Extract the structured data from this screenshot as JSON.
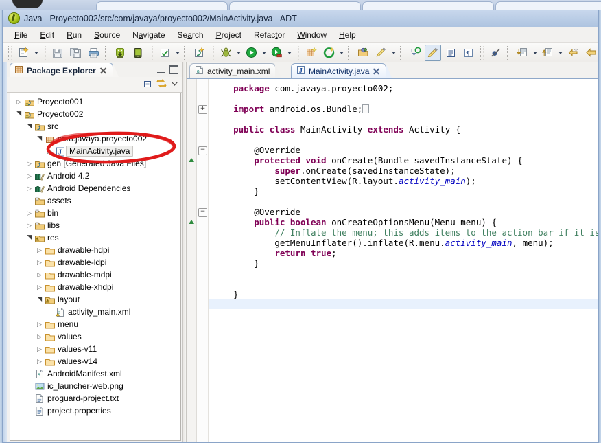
{
  "window": {
    "title": "Java - Proyecto002/src/com/javaya/proyecto002/MainActivity.java - ADT",
    "app_icon": "eclipse-icon"
  },
  "menubar": {
    "items": [
      {
        "label": "File",
        "mnemonic": "F"
      },
      {
        "label": "Edit",
        "mnemonic": "E"
      },
      {
        "label": "Run",
        "mnemonic": "R"
      },
      {
        "label": "Source",
        "mnemonic": "S"
      },
      {
        "label": "Navigate",
        "mnemonic": "N"
      },
      {
        "label": "Search",
        "mnemonic": "a"
      },
      {
        "label": "Project",
        "mnemonic": "P"
      },
      {
        "label": "Refactor",
        "mnemonic": "t"
      },
      {
        "label": "Window",
        "mnemonic": "W"
      },
      {
        "label": "Help",
        "mnemonic": "H"
      }
    ]
  },
  "toolbar": {
    "groups": [
      [
        "new-wizard-icon",
        "dropdown-arrow"
      ],
      [
        "save-icon",
        "save-all-icon",
        "print-icon"
      ],
      [
        "android-sdk-manager-icon",
        "android-virtual-device-manager-icon"
      ],
      [
        "check-build-icon",
        "dropdown-arrow"
      ],
      [
        "new-java-class-icon"
      ],
      [
        "debug-icon",
        "dropdown-arrow",
        "run-icon",
        "dropdown-arrow",
        "run-external-tools-icon",
        "dropdown-arrow"
      ],
      [
        "new-android-xml-icon",
        "refresh-green-icon",
        "dropdown-arrow"
      ],
      [
        "open-package-icon",
        "open-type-icon",
        "dropdown-arrow"
      ],
      [
        "search-declaration-icon",
        "toggle-mark-occurrences-icon",
        "show-whitespace-icon",
        "show-pilcrow-icon"
      ],
      [
        "skip-breakpoints-icon"
      ],
      [
        "next-annotation-icon",
        "dropdown-arrow",
        "previous-annotation-icon",
        "dropdown-arrow",
        "last-edit-location-icon",
        "back-icon",
        "dropdown-arrow",
        "forward-icon"
      ]
    ]
  },
  "explorer": {
    "tab_label": "Package Explorer",
    "tab_icon": "package-explorer-icon",
    "close_icon": "close-icon",
    "minimize_icon": "minimize-icon",
    "maximize_icon": "maximize-icon",
    "toolbar_icons": [
      "collapse-all-icon",
      "link-with-editor-icon",
      "view-menu-icon"
    ],
    "tree": [
      {
        "label": "Proyecto001",
        "indent": 0,
        "twisty": "closed",
        "icon": "java-project-icon"
      },
      {
        "label": "Proyecto002",
        "indent": 0,
        "twisty": "open",
        "icon": "java-project-icon"
      },
      {
        "label": "src",
        "indent": 1,
        "twisty": "open",
        "icon": "source-folder-icon"
      },
      {
        "label": "com.javaya.proyecto002",
        "indent": 2,
        "twisty": "open",
        "icon": "package-icon"
      },
      {
        "label": "MainActivity.java",
        "indent": 3,
        "twisty": "closed",
        "icon": "java-file-icon",
        "selected": true
      },
      {
        "label": "gen [Generated Java Files]",
        "indent": 1,
        "twisty": "closed",
        "icon": "source-folder-icon"
      },
      {
        "label": "Android 4.2",
        "indent": 1,
        "twisty": "closed",
        "icon": "library-icon"
      },
      {
        "label": "Android Dependencies",
        "indent": 1,
        "twisty": "closed",
        "icon": "library-icon"
      },
      {
        "label": "assets",
        "indent": 1,
        "twisty": "none",
        "icon": "folder-badge-icon"
      },
      {
        "label": "bin",
        "indent": 1,
        "twisty": "closed",
        "icon": "folder-badge-icon"
      },
      {
        "label": "libs",
        "indent": 1,
        "twisty": "closed",
        "icon": "folder-badge-icon"
      },
      {
        "label": "res",
        "indent": 1,
        "twisty": "open",
        "icon": "folder-warning-icon"
      },
      {
        "label": "drawable-hdpi",
        "indent": 2,
        "twisty": "closed",
        "icon": "folder-icon"
      },
      {
        "label": "drawable-ldpi",
        "indent": 2,
        "twisty": "closed",
        "icon": "folder-icon"
      },
      {
        "label": "drawable-mdpi",
        "indent": 2,
        "twisty": "closed",
        "icon": "folder-icon"
      },
      {
        "label": "drawable-xhdpi",
        "indent": 2,
        "twisty": "closed",
        "icon": "folder-icon"
      },
      {
        "label": "layout",
        "indent": 2,
        "twisty": "open",
        "icon": "folder-warning-icon"
      },
      {
        "label": "activity_main.xml",
        "indent": 3,
        "twisty": "none",
        "icon": "xml-warning-file-icon"
      },
      {
        "label": "menu",
        "indent": 2,
        "twisty": "closed",
        "icon": "folder-icon"
      },
      {
        "label": "values",
        "indent": 2,
        "twisty": "closed",
        "icon": "folder-icon"
      },
      {
        "label": "values-v11",
        "indent": 2,
        "twisty": "closed",
        "icon": "folder-icon"
      },
      {
        "label": "values-v14",
        "indent": 2,
        "twisty": "closed",
        "icon": "folder-icon"
      },
      {
        "label": "AndroidManifest.xml",
        "indent": 1,
        "twisty": "none",
        "icon": "xml-file-icon"
      },
      {
        "label": "ic_launcher-web.png",
        "indent": 1,
        "twisty": "none",
        "icon": "image-file-icon"
      },
      {
        "label": "proguard-project.txt",
        "indent": 1,
        "twisty": "none",
        "icon": "text-file-icon"
      },
      {
        "label": "project.properties",
        "indent": 1,
        "twisty": "none",
        "icon": "text-file-icon"
      }
    ]
  },
  "editor": {
    "tabs": [
      {
        "label": "activity_main.xml",
        "icon": "xml-file-icon",
        "active": false,
        "closable": false
      },
      {
        "label": "MainActivity.java",
        "icon": "java-file-icon",
        "active": true,
        "closable": true
      }
    ],
    "minimize_icon": "minimize-icon",
    "maximize_icon": "maximize-icon",
    "code_lines": [
      {
        "tokens": [
          {
            "t": "package ",
            "c": "kw"
          },
          {
            "t": "com.javaya.proyecto002;",
            "c": "pln"
          }
        ],
        "indent": 1
      },
      {
        "tokens": [],
        "indent": 0
      },
      {
        "tokens": [
          {
            "t": "import ",
            "c": "kw"
          },
          {
            "t": "android.os.Bundle;",
            "c": "pln"
          },
          {
            "t": "□",
            "c": "box"
          }
        ],
        "indent": 1,
        "fold": "plus"
      },
      {
        "tokens": [],
        "indent": 0
      },
      {
        "tokens": [
          {
            "t": "public class ",
            "c": "kw"
          },
          {
            "t": "MainActivity ",
            "c": "pln"
          },
          {
            "t": "extends ",
            "c": "kw"
          },
          {
            "t": "Activity {",
            "c": "pln"
          }
        ],
        "indent": 1
      },
      {
        "tokens": [],
        "indent": 0
      },
      {
        "tokens": [
          {
            "t": "@Override",
            "c": "pln"
          }
        ],
        "indent": 2,
        "fold": "minus"
      },
      {
        "tokens": [
          {
            "t": "protected void ",
            "c": "kw"
          },
          {
            "t": "onCreate(Bundle savedInstanceState) {",
            "c": "pln"
          }
        ],
        "indent": 2,
        "marker": "green"
      },
      {
        "tokens": [
          {
            "t": "super",
            "c": "kw"
          },
          {
            "t": ".onCreate(savedInstanceState);",
            "c": "pln"
          }
        ],
        "indent": 3
      },
      {
        "tokens": [
          {
            "t": "setContentView(R.layout.",
            "c": "pln"
          },
          {
            "t": "activity_main",
            "c": "fld"
          },
          {
            "t": ");",
            "c": "pln"
          }
        ],
        "indent": 3
      },
      {
        "tokens": [
          {
            "t": "}",
            "c": "pln"
          }
        ],
        "indent": 2
      },
      {
        "tokens": [],
        "indent": 0
      },
      {
        "tokens": [
          {
            "t": "@Override",
            "c": "pln"
          }
        ],
        "indent": 2,
        "fold": "minus"
      },
      {
        "tokens": [
          {
            "t": "public boolean ",
            "c": "kw"
          },
          {
            "t": "onCreateOptionsMenu(Menu menu) {",
            "c": "pln"
          }
        ],
        "indent": 2,
        "marker": "green"
      },
      {
        "tokens": [
          {
            "t": "// Inflate the menu; this adds items to the action bar if it is present",
            "c": "cmt"
          }
        ],
        "indent": 3
      },
      {
        "tokens": [
          {
            "t": "getMenuInflater().inflate(R.menu.",
            "c": "pln"
          },
          {
            "t": "activity_main",
            "c": "fld"
          },
          {
            "t": ", menu);",
            "c": "pln"
          }
        ],
        "indent": 3
      },
      {
        "tokens": [
          {
            "t": "return true",
            "c": "kw"
          },
          {
            "t": ";",
            "c": "pln"
          }
        ],
        "indent": 3
      },
      {
        "tokens": [
          {
            "t": "}",
            "c": "pln"
          }
        ],
        "indent": 2
      },
      {
        "tokens": [],
        "indent": 0
      },
      {
        "tokens": [],
        "indent": 0
      },
      {
        "tokens": [
          {
            "t": "}",
            "c": "pln"
          }
        ],
        "indent": 1
      },
      {
        "tokens": [],
        "indent": 0,
        "current": true
      }
    ]
  },
  "annotation": {
    "shape": "red-oval-highlight",
    "target": "MainActivity.java",
    "color": "#e01b1b"
  },
  "colors": {
    "keyword": "#7f0055",
    "comment": "#3f7f5f",
    "field": "#0000c0",
    "current_line": "#e8f1fd",
    "titlebar_start": "#c9d8ed",
    "titlebar_end": "#aec4e0",
    "annotation_red": "#e01b1b"
  }
}
